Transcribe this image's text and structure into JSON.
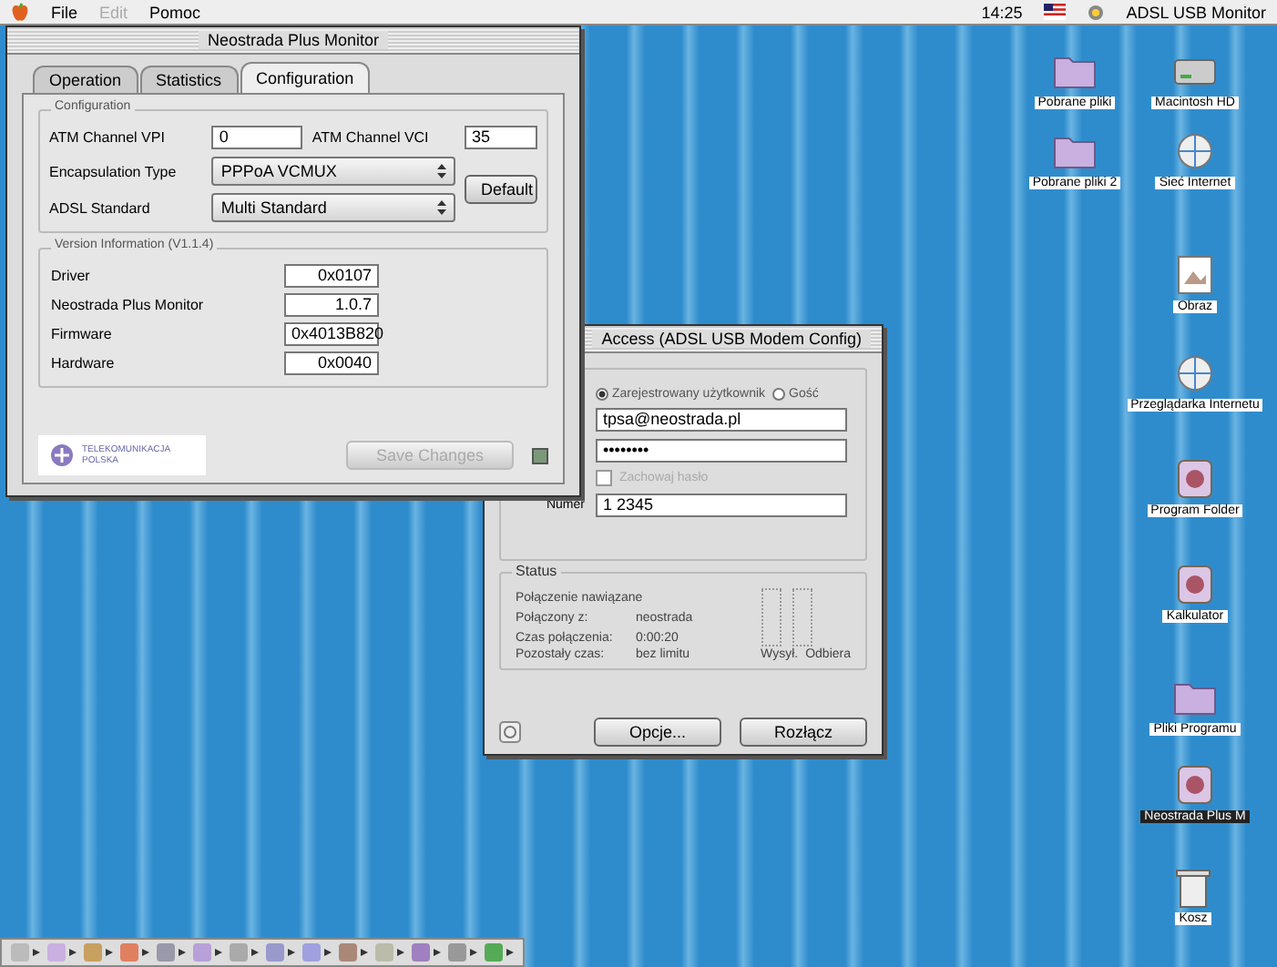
{
  "menu_bar": {
    "items": [
      {
        "label": "File",
        "disabled": false
      },
      {
        "label": "Edit",
        "disabled": true
      },
      {
        "label": "Pomoc",
        "disabled": false
      }
    ],
    "clock": "14:25",
    "app_name": "ADSL USB Monitor"
  },
  "monitor_window": {
    "title": "Neostrada Plus Monitor",
    "tabs": [
      {
        "label": "Operation",
        "selected": false
      },
      {
        "label": "Statistics",
        "selected": false
      },
      {
        "label": "Configuration",
        "selected": true
      }
    ],
    "configuration": {
      "title": "Configuration",
      "vpi_label": "ATM Channel VPI",
      "vpi_value": "0",
      "vci_label": "ATM Channel VCI",
      "vci_value": "35",
      "encapsulation_label": "Encapsulation Type",
      "encapsulation_value": "PPPoA VCMUX",
      "standard_label": "ADSL Standard",
      "standard_value": "Multi Standard",
      "default_button": "Default"
    },
    "version": {
      "title": "Version Information (V1.1.4)",
      "rows": [
        {
          "label": "Driver",
          "value": "0x0107"
        },
        {
          "label": "Neostrada Plus Monitor",
          "value": "1.0.7"
        },
        {
          "label": "Firmware",
          "value": "0x4013B820"
        },
        {
          "label": "Hardware",
          "value": "0x0040"
        }
      ]
    },
    "logo_text": "TELEKOMUNIKACJA POLSKA",
    "save_button": {
      "label": "Save Changes",
      "disabled": true
    }
  },
  "remote_window": {
    "title": "Access (ADSL USB Modem Config)",
    "radios": [
      {
        "label": "Zarejestrowany użytkownik",
        "selected": true
      },
      {
        "label": "Gość",
        "selected": false
      }
    ],
    "user_value": "tpsa@neostrada.pl",
    "password_value": "••••••••",
    "save_password": {
      "label": "Zachowaj hasło",
      "checked": false,
      "disabled": true
    },
    "number_label": "Numer",
    "number_value": "1 2345",
    "status": {
      "title": "Status",
      "first_line": "Połączenie nawiązane",
      "lines": [
        {
          "label": "Połączony z:",
          "value": "neostrada"
        },
        {
          "label": "Czas połączenia:",
          "value": "0:00:20"
        },
        {
          "label": "Pozostały czas:",
          "value": "bez limitu"
        }
      ],
      "meter_labels": [
        "Wysył.",
        "Odbiera"
      ]
    },
    "buttons": [
      "Opcje...",
      "Rozłącz"
    ]
  },
  "desktop_icons": [
    {
      "label": "Pobrane pliki",
      "kind": "folder",
      "selected": false
    },
    {
      "label": "Macintosh HD",
      "kind": "disk",
      "selected": false
    },
    {
      "label": "Pobrane pliki 2",
      "kind": "folder",
      "selected": false
    },
    {
      "label": "Sieć Internet",
      "kind": "globe",
      "selected": false
    },
    {
      "label": "Obraz",
      "kind": "picture",
      "selected": false
    },
    {
      "label": "Przeglądarka Internetu",
      "kind": "globe",
      "selected": false
    },
    {
      "label": "Program Folder",
      "kind": "app",
      "selected": false
    },
    {
      "label": "Kalkulator",
      "kind": "app",
      "selected": false
    },
    {
      "label": "Pliki Programu",
      "kind": "folder",
      "selected": false
    },
    {
      "label": "Neostrada Plus M",
      "kind": "app",
      "selected": true
    },
    {
      "label": "Kosz",
      "kind": "trash",
      "selected": false
    }
  ]
}
